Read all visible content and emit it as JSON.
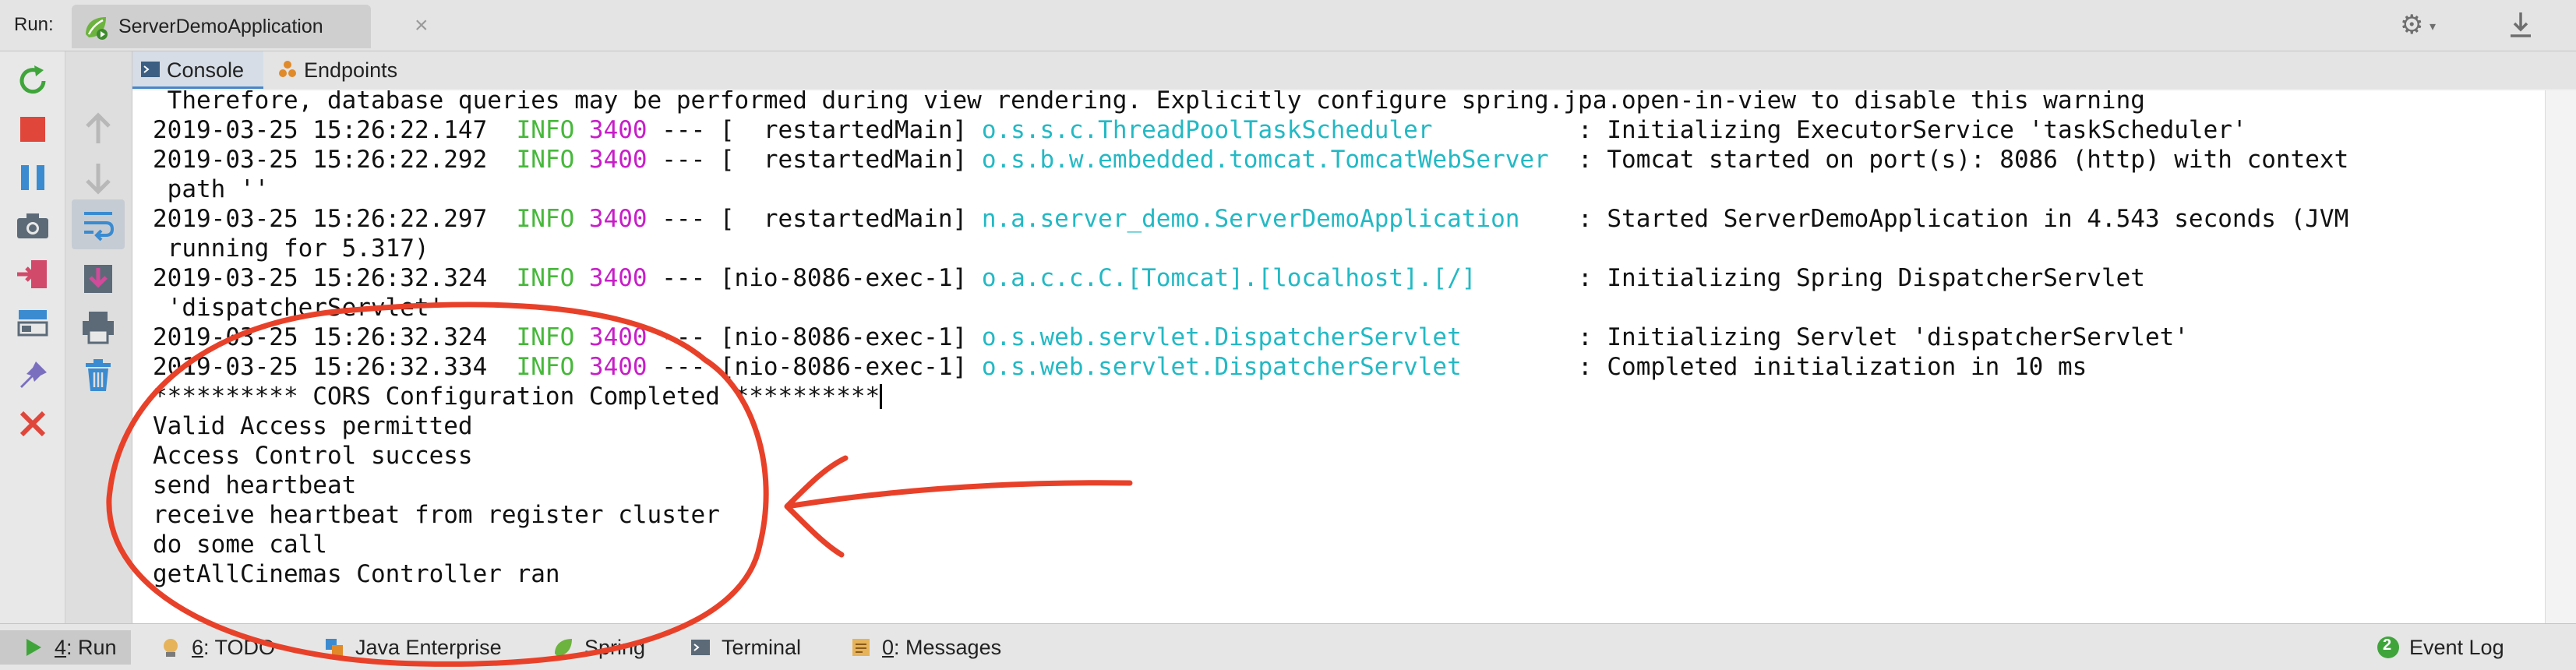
{
  "run_bar": {
    "label": "Run:",
    "tab_label": "ServerDemoApplication",
    "close_glyph": "×",
    "icons": [
      "spring-run-icon",
      "close-icon",
      "gear-icon",
      "download-icon"
    ]
  },
  "left_toolbar": {
    "icons": [
      "rerun-icon",
      "stop-icon",
      "pause-icon",
      "camera-icon",
      "exit-icon",
      "layout-icon",
      "pin-icon",
      "close-icon"
    ]
  },
  "left_toolbar2": {
    "icons": [
      "up-arrow-icon",
      "down-arrow-icon",
      "soft-wrap-icon",
      "scroll-to-end-icon",
      "print-icon",
      "trash-icon"
    ]
  },
  "console_tabs": [
    {
      "label": "Console",
      "active": true,
      "icon": "console-icon"
    },
    {
      "label": "Endpoints",
      "active": false,
      "icon": "endpoints-icon"
    }
  ],
  "console": {
    "lines": [
      {
        "text": " Therefore, database queries may be performed during view rendering. Explicitly configure spring.jpa.open-in-view to disable this warning"
      },
      {
        "date": "2019-03-25 15:26:22.147",
        "level": "INFO",
        "pid": "3400",
        "sep": " --- ",
        "thread": "[  restartedMain]",
        "logger": "o.s.s.c.ThreadPoolTaskScheduler",
        "pad": "          ",
        "msg": ": Initializing ExecutorService 'taskScheduler'"
      },
      {
        "date": "2019-03-25 15:26:22.292",
        "level": "INFO",
        "pid": "3400",
        "sep": " --- ",
        "thread": "[  restartedMain]",
        "logger": "o.s.b.w.embedded.tomcat.TomcatWebServer",
        "pad": "  ",
        "msg": ": Tomcat started on port(s): 8086 (http) with context"
      },
      {
        "text": " path ''"
      },
      {
        "date": "2019-03-25 15:26:22.297",
        "level": "INFO",
        "pid": "3400",
        "sep": " --- ",
        "thread": "[  restartedMain]",
        "logger": "n.a.server_demo.ServerDemoApplication",
        "pad": "    ",
        "msg": ": Started ServerDemoApplication in 4.543 seconds (JVM"
      },
      {
        "text": " running for 5.317)"
      },
      {
        "date": "2019-03-25 15:26:32.324",
        "level": "INFO",
        "pid": "3400",
        "sep": " --- ",
        "thread": "[nio-8086-exec-1]",
        "logger": "o.a.c.c.C.[Tomcat].[localhost].[/]",
        "pad": "       ",
        "msg": ": Initializing Spring DispatcherServlet"
      },
      {
        "text": " 'dispatcherServlet'"
      },
      {
        "date": "2019-03-25 15:26:32.324",
        "level": "INFO",
        "pid": "3400",
        "sep": " --- ",
        "thread": "[nio-8086-exec-1]",
        "logger": "o.s.web.servlet.DispatcherServlet",
        "pad": "        ",
        "msg": ": Initializing Servlet 'dispatcherServlet'"
      },
      {
        "date": "2019-03-25 15:26:32.334",
        "level": "INFO",
        "pid": "3400",
        "sep": " --- ",
        "thread": "[nio-8086-exec-1]",
        "logger": "o.s.web.servlet.DispatcherServlet",
        "pad": "        ",
        "msg": ": Completed initialization in 10 ms"
      },
      {
        "text": "********** CORS Configuration Completed **********",
        "caret": true
      },
      {
        "text": "Valid Access permitted"
      },
      {
        "text": "Access Control success"
      },
      {
        "text": "send heartbeat"
      },
      {
        "text": "receive heartbeat from register cluster"
      },
      {
        "text": "do some call"
      },
      {
        "text": "getAllCinemas Controller ran"
      }
    ]
  },
  "bottom_bar": [
    {
      "label": "4: Run",
      "icon": "run-icon"
    },
    {
      "label": "6: TODO",
      "icon": "todo-icon"
    },
    {
      "label": "Java Enterprise",
      "icon": "java-enterprise-icon"
    },
    {
      "label": "Spring",
      "icon": "spring-icon"
    },
    {
      "label": "Terminal",
      "icon": "terminal-icon"
    },
    {
      "label": "0: Messages",
      "icon": "messages-icon"
    },
    {
      "label": "Event Log",
      "icon": "event-log-icon",
      "badge": "2"
    }
  ],
  "colors": {
    "info": "#46b83a",
    "pid": "#c81ec8",
    "logger": "#23b9c4",
    "annotation": "#e8412a"
  }
}
